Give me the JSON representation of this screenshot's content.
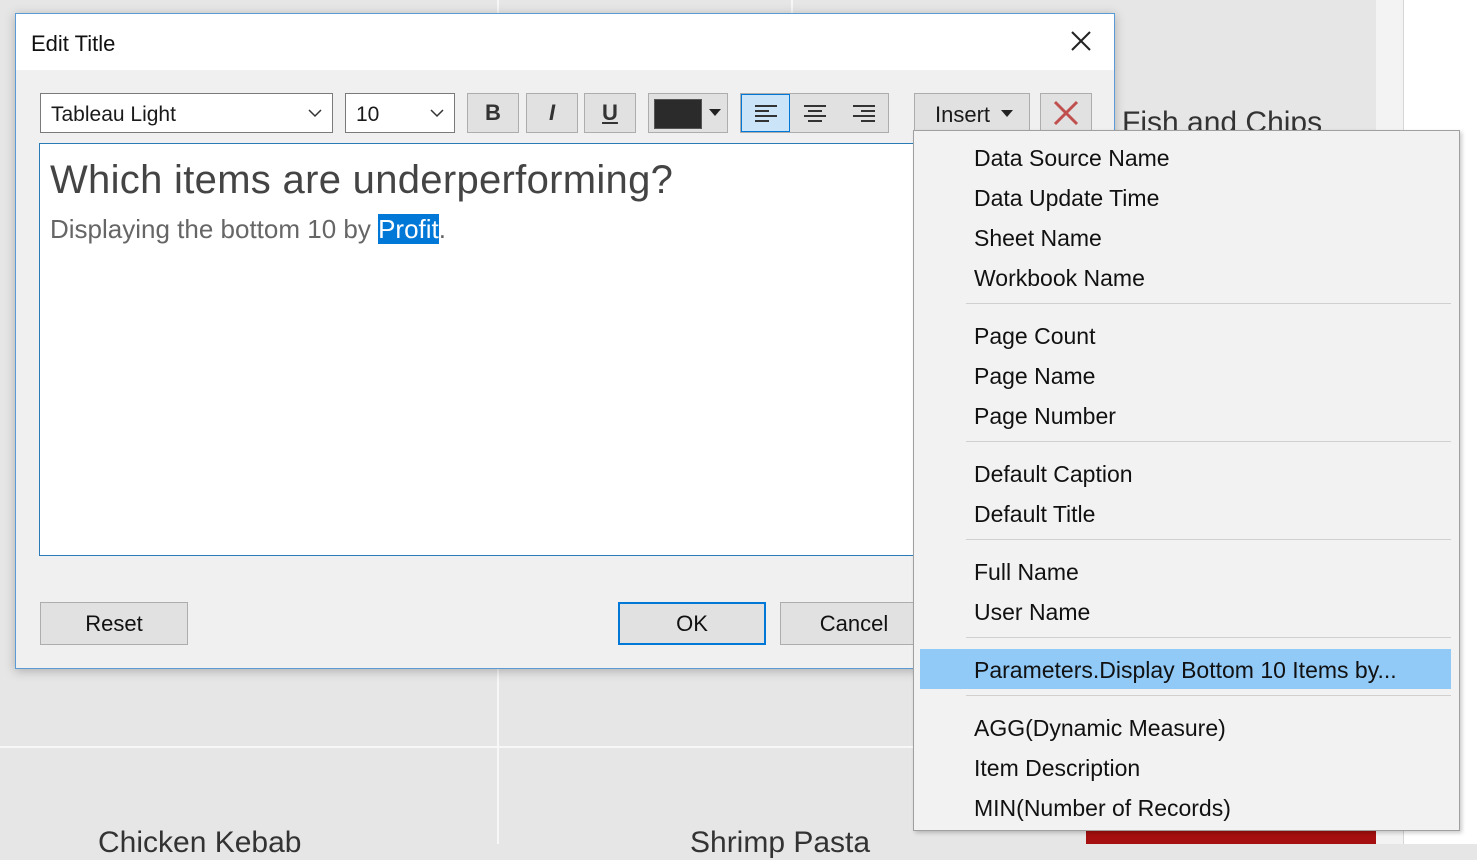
{
  "background": {
    "top_right_label": "Fish and Chips",
    "bottom_labels": [
      "Chicken Kebab",
      "Shrimp Pasta"
    ]
  },
  "dialog": {
    "title": "Edit Title",
    "font_name": "Tableau Light",
    "font_size": "10",
    "bold_label": "B",
    "italic_label": "I",
    "underline_label": "U",
    "text_color": "#2b2b2b",
    "insert_label": "Insert",
    "editor": {
      "title_line": "Which items are underperforming?",
      "subtitle_prefix": "Displaying the bottom 10 by ",
      "subtitle_selected": "Profit",
      "subtitle_suffix": "."
    },
    "buttons": {
      "reset": "Reset",
      "ok": "OK",
      "cancel": "Cancel"
    }
  },
  "insert_menu": {
    "groups": [
      [
        "Data Source Name",
        "Data Update Time",
        "Sheet Name",
        "Workbook Name"
      ],
      [
        "Page Count",
        "Page Name",
        "Page Number"
      ],
      [
        "Default Caption",
        "Default Title"
      ],
      [
        "Full Name",
        "User Name"
      ],
      [
        "Parameters.Display Bottom 10 Items by..."
      ],
      [
        "AGG(Dynamic Measure)",
        "Item Description",
        "MIN(Number of Records)"
      ]
    ],
    "highlighted": "Parameters.Display Bottom 10 Items by..."
  },
  "colors": {
    "accent": "#0078d7",
    "highlight": "#91c9f7",
    "delete_x": "#c0504d"
  }
}
